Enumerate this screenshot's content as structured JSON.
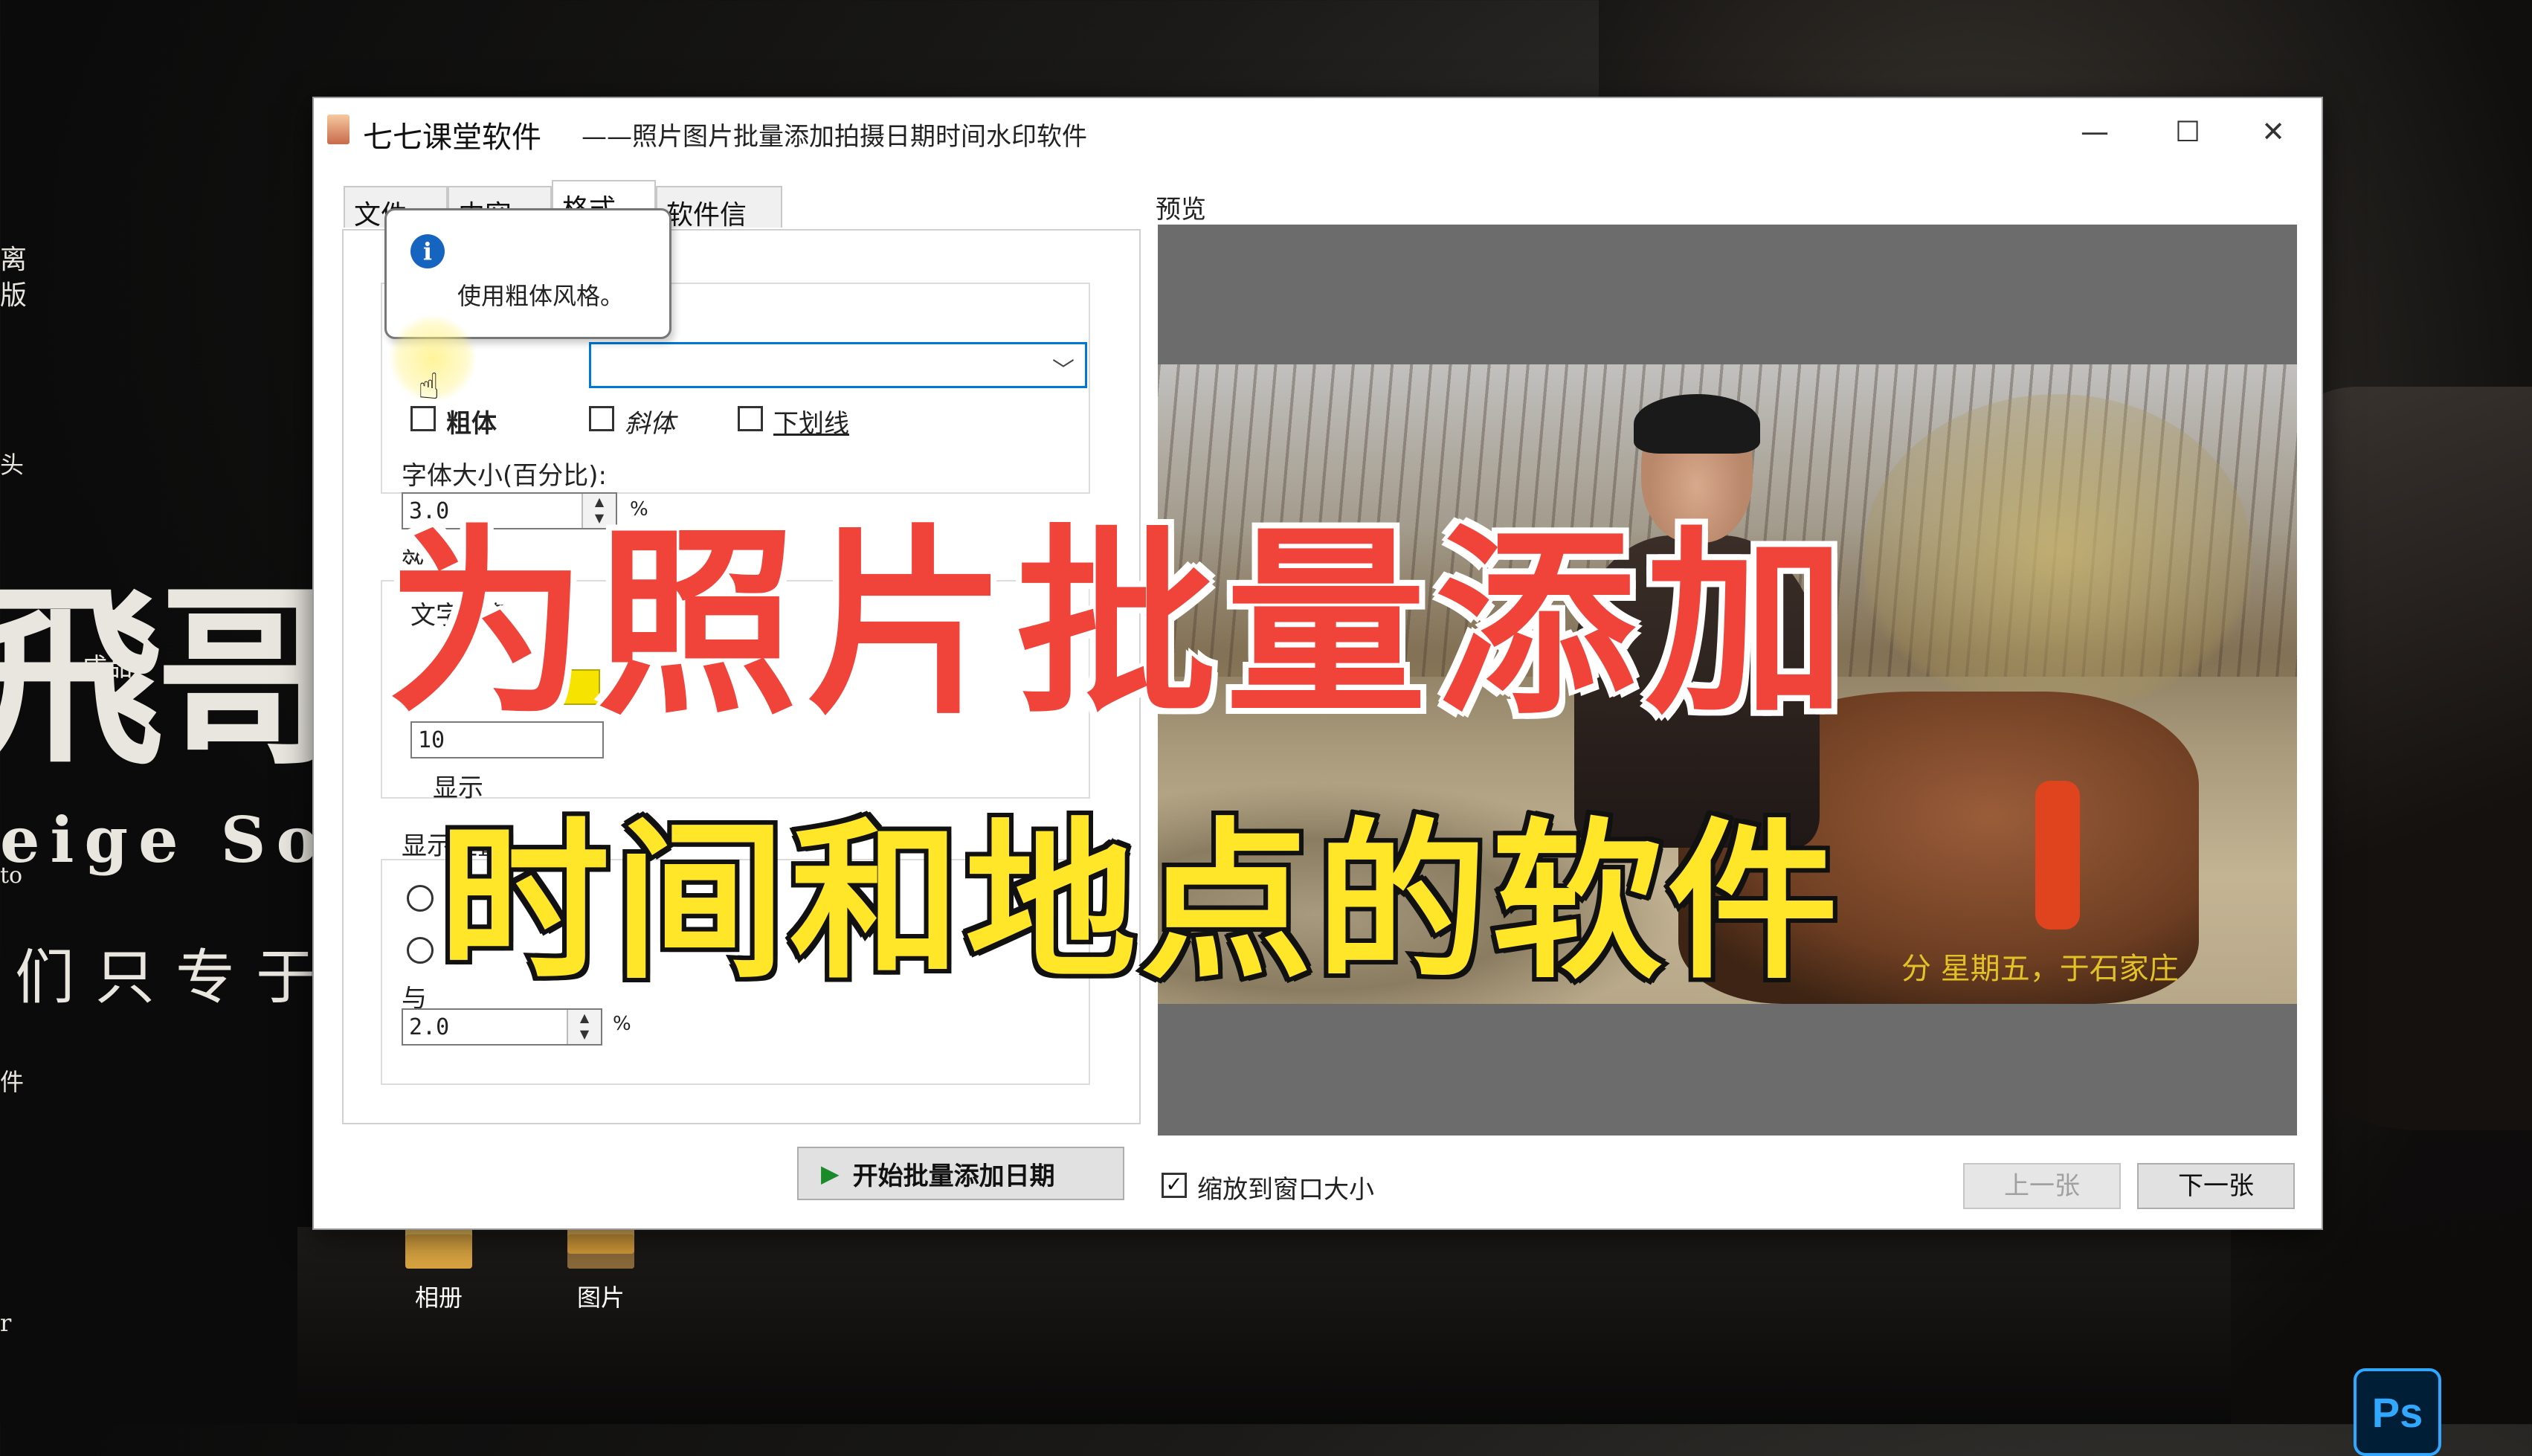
{
  "window": {
    "title": "七七课堂软件",
    "subtitle": "——照片图片批量添加拍摄日期时间水印软件",
    "controls": {
      "minimize": "—",
      "maximize": "☐",
      "close": "✕"
    }
  },
  "tabs": [
    {
      "label": "文件"
    },
    {
      "label": "内容"
    },
    {
      "label": "格式"
    },
    {
      "label": "软件信息"
    }
  ],
  "format": {
    "tooltip_text": "使用粗体风格。",
    "tooltip_icon": "info-icon",
    "bold_label": "粗体",
    "italic_label": "斜体",
    "underline_label": "下划线",
    "font_size_label": "字体大小(百分比):",
    "font_size_value": "3.0",
    "percent_unit": "%",
    "effects_label": "效果",
    "text_color_label": "文字颜色",
    "text_color": "#f7e300",
    "effect_value": "10",
    "display_label": "显示",
    "position_label": "显示位置",
    "edge_label": "与",
    "edge_value": "2.0",
    "edge_unit": "%"
  },
  "start_button": {
    "label": "开始批量添加日期",
    "icon": "play-icon"
  },
  "preview": {
    "label": "预览",
    "watermark_text": "分 星期五，于石家庄",
    "zoom_label": "缩放到窗口大小",
    "zoom_checked": true,
    "prev_button": "上一张",
    "next_button": "下一张"
  },
  "desktop": {
    "icons": [
      {
        "label": "相册"
      },
      {
        "label": "图片"
      }
    ],
    "left_text": {
      "line1": "离",
      "line2": "版",
      "brand_cn": "飛哥",
      "brand_small": "成品",
      "brand_en": "eige So",
      "brand_en_small": "to",
      "slogan": "们只专于",
      "misc1": "件",
      "misc2": "r",
      "misc3": "头"
    },
    "ps_label": "Ps"
  },
  "overlay": {
    "title": "为照片批量添加",
    "subtitle": "时间和地点的软件"
  }
}
